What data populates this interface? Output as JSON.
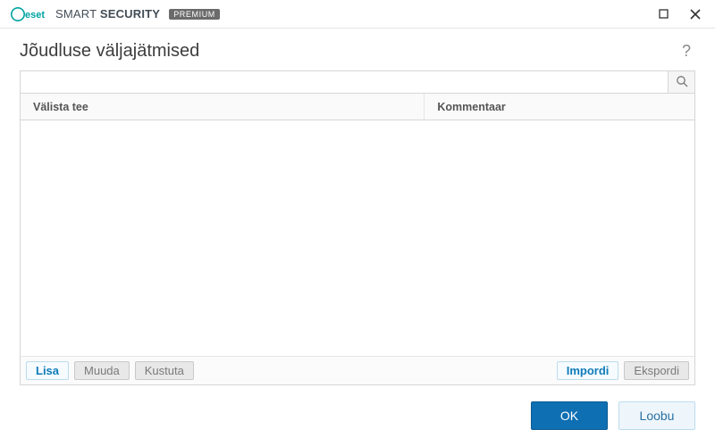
{
  "brand": {
    "name_light": "SMART",
    "name_bold": "SECURITY",
    "badge": "PREMIUM"
  },
  "page": {
    "title": "Jõudluse väljajätmised"
  },
  "search": {
    "value": "",
    "placeholder": ""
  },
  "table": {
    "columns": {
      "path": "Välista tee",
      "comment": "Kommentaar"
    },
    "rows": []
  },
  "actions": {
    "add": "Lisa",
    "edit": "Muuda",
    "delete": "Kustuta",
    "import": "Impordi",
    "export": "Ekspordi"
  },
  "footer": {
    "ok": "OK",
    "cancel": "Loobu"
  }
}
